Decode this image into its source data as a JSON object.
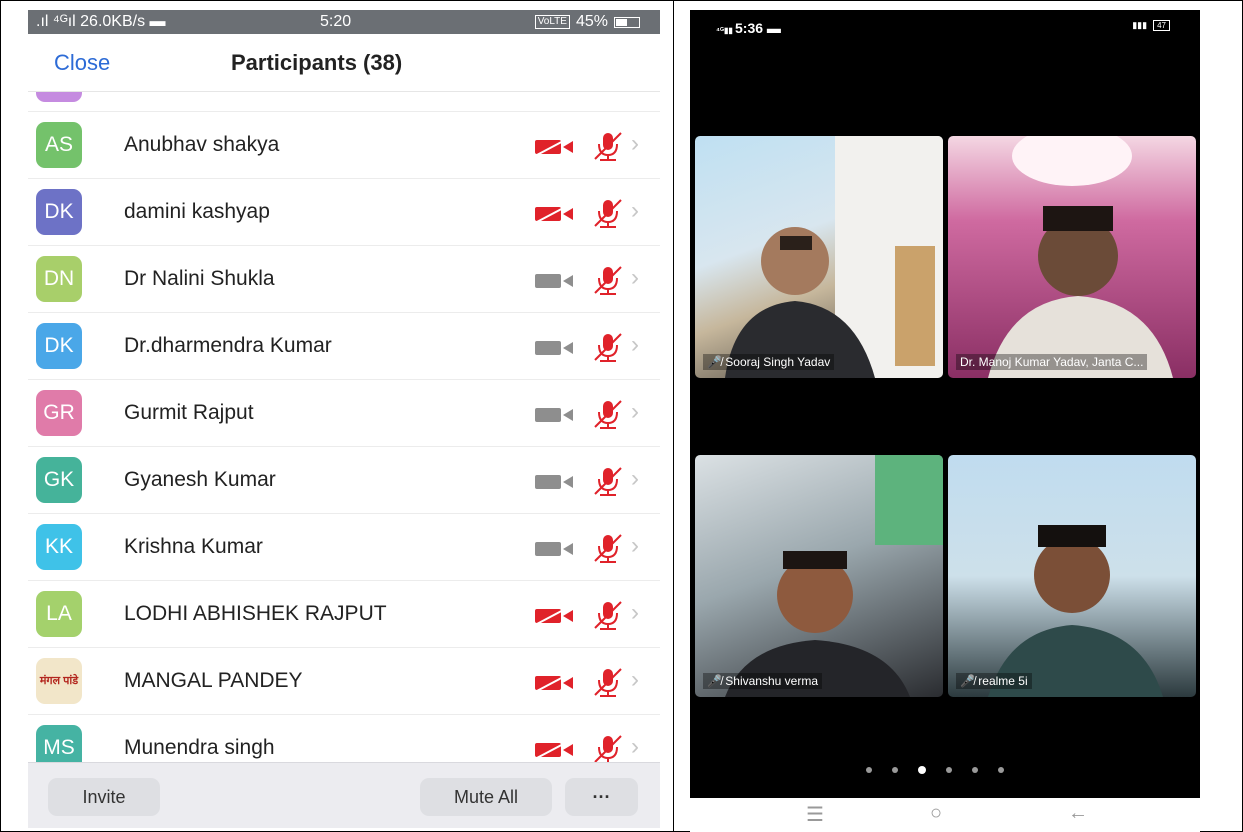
{
  "left_phone": {
    "status": {
      "left": ".ıl ⁴ᴳıl 26.0KB/s ▬",
      "time": "5:20",
      "volte": "VoLTE",
      "battery": "45%"
    },
    "close_label": "Close",
    "title": "Participants (38)",
    "participants": [
      {
        "initials": "AS",
        "name": "Anubhav shakya",
        "color": "#74c26b",
        "video": "off"
      },
      {
        "initials": "DK",
        "name": "damini kashyap",
        "color": "#6d72c6",
        "video": "off"
      },
      {
        "initials": "DN",
        "name": "Dr Nalini Shukla",
        "color": "#a8cf6a",
        "video": "muted"
      },
      {
        "initials": "DK",
        "name": "Dr.dharmendra Kumar",
        "color": "#4aa7e8",
        "video": "muted"
      },
      {
        "initials": "GR",
        "name": "Gurmit Rajput",
        "color": "#e07ba9",
        "video": "muted"
      },
      {
        "initials": "GK",
        "name": "Gyanesh Kumar",
        "color": "#45b39a",
        "video": "muted"
      },
      {
        "initials": "KK",
        "name": "Krishna Kumar",
        "color": "#3fc2e8",
        "video": "muted"
      },
      {
        "initials": "LA",
        "name": "LODHI ABHISHEK RAJPUT",
        "color": "#a4d16c",
        "video": "off"
      },
      {
        "initials": "",
        "name": "MANGAL PANDEY",
        "color": "#f2e6c9",
        "video": "off",
        "image": true,
        "image_text": "मंगल पांडे"
      },
      {
        "initials": "MS",
        "name": "Munendra singh",
        "color": "#45b3a3",
        "video": "off"
      }
    ],
    "buttons": {
      "invite": "Invite",
      "mute_all": "Mute All",
      "more": "···"
    }
  },
  "right_phone": {
    "status_time": "5:36",
    "tiles": [
      {
        "label": "Sooraj Singh Yadav"
      },
      {
        "label": "Dr. Manoj Kumar Yadav, Janta C..."
      },
      {
        "label": "Shivanshu verma"
      },
      {
        "label": "realme 5i"
      }
    ],
    "page_count": 6,
    "active_page": 3
  },
  "colors": {
    "accent": "#2d6bd6",
    "muted_red": "#e0222a",
    "grey_icon": "#8e8e8e"
  }
}
